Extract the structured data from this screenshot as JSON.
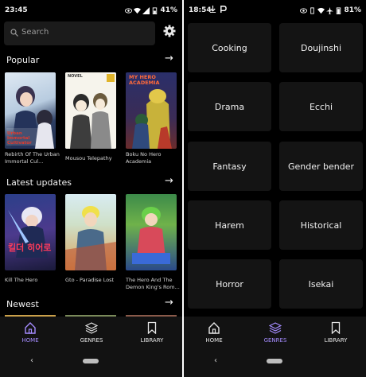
{
  "left_screen": {
    "status": {
      "time": "23:45",
      "battery": "41%"
    },
    "search": {
      "placeholder": "Search"
    },
    "popular": {
      "title": "Popular",
      "items": [
        {
          "caption": "Rebirth Of The Urban Immortal Cul...",
          "cover_text": "Urban Immortal Cultivator"
        },
        {
          "caption": "Mousou Telepathy",
          "cover_text": "NOVEL"
        },
        {
          "caption": "Boku No Hero Academia",
          "cover_text": "MY HERO ACADEMIA"
        }
      ]
    },
    "latest": {
      "title": "Latest updates",
      "items": [
        {
          "caption": "Kill The Hero",
          "cover_text": "킬더 히어로"
        },
        {
          "caption": "Gto - Paradise Lost",
          "cover_text": ""
        },
        {
          "caption": "The Hero And The Demon King's Rom...",
          "cover_text": ""
        }
      ]
    },
    "newest": {
      "title": "Newest"
    },
    "nav": [
      {
        "label": "HOME",
        "icon": "home-icon",
        "active": true
      },
      {
        "label": "GENRES",
        "icon": "layers-icon",
        "active": false
      },
      {
        "label": "LIBRARY",
        "icon": "bookmark-icon",
        "active": false
      }
    ]
  },
  "right_screen": {
    "status": {
      "time": "18:54",
      "battery": "81%"
    },
    "genres": [
      "Cooking",
      "Doujinshi",
      "Drama",
      "Ecchi",
      "Fantasy",
      "Gender bender",
      "Harem",
      "Historical",
      "Horror",
      "Isekai"
    ],
    "nav": [
      {
        "label": "HOME",
        "icon": "home-icon",
        "active": false
      },
      {
        "label": "GENRES",
        "icon": "layers-icon",
        "active": true
      },
      {
        "label": "LIBRARY",
        "icon": "bookmark-icon",
        "active": false
      }
    ]
  },
  "colors": {
    "accent": "#a58cff",
    "background": "#000000",
    "card": "#141414"
  }
}
